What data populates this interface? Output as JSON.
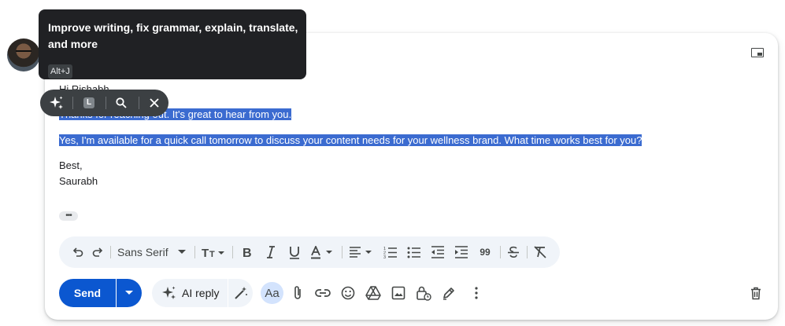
{
  "tooltip": {
    "text": "Improve writing, fix grammar, explain, translate, and more",
    "shortcut": "Alt+J"
  },
  "ai_toolbar": {
    "badge": "L",
    "icons": [
      "sparkle-icon",
      "search-icon",
      "close-icon"
    ]
  },
  "email_body": {
    "greeting": "Hi Rishabh",
    "line1": "Thanks for reaching out. It's great to hear from you.",
    "line2": "Yes, I'm available for a quick call tomorrow to discuss your content needs for your wellness brand. What time works best for you?",
    "signoff": "Best,",
    "name": "Saurabh",
    "ellipsis": "•••"
  },
  "format_toolbar": {
    "font": "Sans Serif",
    "quote": "99"
  },
  "bottom_bar": {
    "send_label": "Send",
    "ai_reply_label": "AI reply",
    "aa_label": "Aa"
  },
  "colors": {
    "selection": "#3b6bd0",
    "send": "#0b57d0",
    "toolbar_bg": "#f0f4f9",
    "dark_pill": "#3c4043"
  }
}
